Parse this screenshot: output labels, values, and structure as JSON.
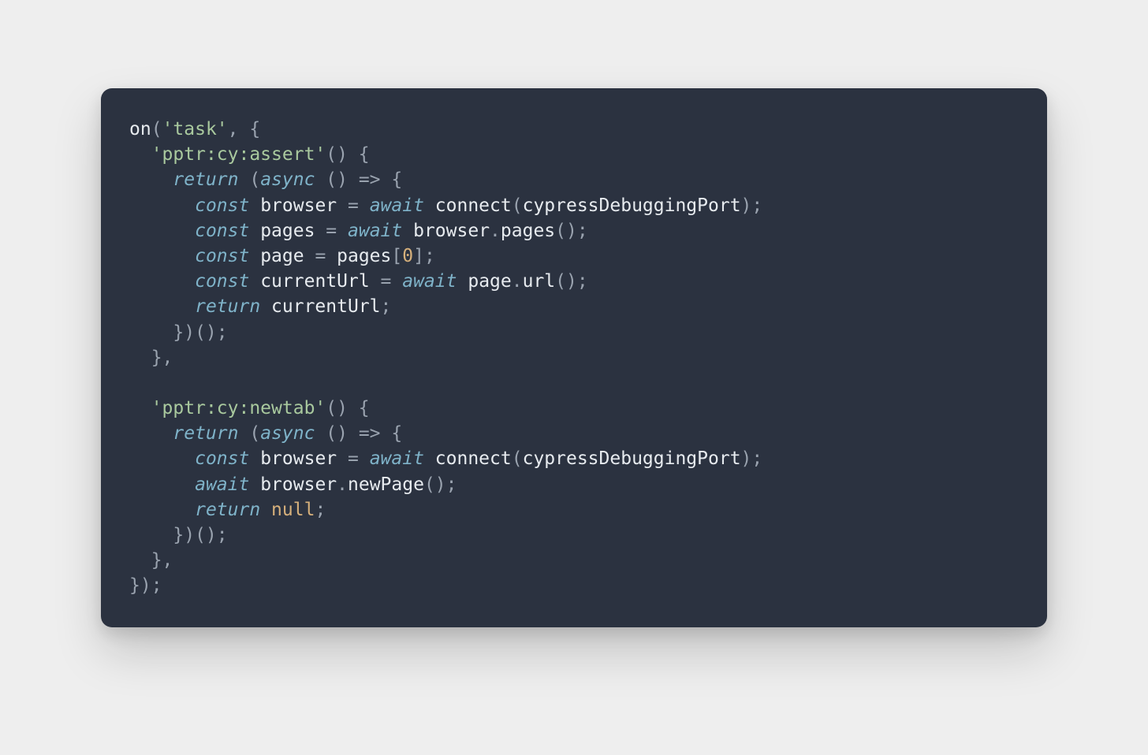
{
  "code": {
    "tokens": [
      [
        [
          "fn",
          "on"
        ],
        [
          "pun",
          "("
        ],
        [
          "str",
          "'task'"
        ],
        [
          "pun",
          ", {"
        ]
      ],
      [
        [
          "pun",
          "  "
        ],
        [
          "str",
          "'pptr:cy:assert'"
        ],
        [
          "pun",
          "() {"
        ]
      ],
      [
        [
          "pun",
          "    "
        ],
        [
          "kw",
          "return"
        ],
        [
          "pun",
          " ("
        ],
        [
          "kw",
          "async"
        ],
        [
          "pun",
          " () "
        ],
        [
          "pun",
          "=>"
        ],
        [
          "pun",
          " {"
        ]
      ],
      [
        [
          "pun",
          "      "
        ],
        [
          "kw",
          "const"
        ],
        [
          "pun",
          " "
        ],
        [
          "ident",
          "browser"
        ],
        [
          "pun",
          " = "
        ],
        [
          "kw",
          "await"
        ],
        [
          "pun",
          " "
        ],
        [
          "call",
          "connect"
        ],
        [
          "pun",
          "("
        ],
        [
          "ident",
          "cypressDebuggingPort"
        ],
        [
          "pun",
          ");"
        ]
      ],
      [
        [
          "pun",
          "      "
        ],
        [
          "kw",
          "const"
        ],
        [
          "pun",
          " "
        ],
        [
          "ident",
          "pages"
        ],
        [
          "pun",
          " = "
        ],
        [
          "kw",
          "await"
        ],
        [
          "pun",
          " "
        ],
        [
          "ident",
          "browser"
        ],
        [
          "pun",
          "."
        ],
        [
          "call",
          "pages"
        ],
        [
          "pun",
          "();"
        ]
      ],
      [
        [
          "pun",
          "      "
        ],
        [
          "kw",
          "const"
        ],
        [
          "pun",
          " "
        ],
        [
          "ident",
          "page"
        ],
        [
          "pun",
          " = "
        ],
        [
          "ident",
          "pages"
        ],
        [
          "pun",
          "["
        ],
        [
          "num",
          "0"
        ],
        [
          "pun",
          "];"
        ]
      ],
      [
        [
          "pun",
          "      "
        ],
        [
          "kw",
          "const"
        ],
        [
          "pun",
          " "
        ],
        [
          "ident",
          "currentUrl"
        ],
        [
          "pun",
          " = "
        ],
        [
          "kw",
          "await"
        ],
        [
          "pun",
          " "
        ],
        [
          "ident",
          "page"
        ],
        [
          "pun",
          "."
        ],
        [
          "call",
          "url"
        ],
        [
          "pun",
          "();"
        ]
      ],
      [
        [
          "pun",
          "      "
        ],
        [
          "kw",
          "return"
        ],
        [
          "pun",
          " "
        ],
        [
          "ident",
          "currentUrl"
        ],
        [
          "pun",
          ";"
        ]
      ],
      [
        [
          "pun",
          "    })();"
        ]
      ],
      [
        [
          "pun",
          "  },"
        ]
      ],
      [
        [
          "pun",
          ""
        ]
      ],
      [
        [
          "pun",
          "  "
        ],
        [
          "str",
          "'pptr:cy:newtab'"
        ],
        [
          "pun",
          "() {"
        ]
      ],
      [
        [
          "pun",
          "    "
        ],
        [
          "kw",
          "return"
        ],
        [
          "pun",
          " ("
        ],
        [
          "kw",
          "async"
        ],
        [
          "pun",
          " () "
        ],
        [
          "pun",
          "=>"
        ],
        [
          "pun",
          " {"
        ]
      ],
      [
        [
          "pun",
          "      "
        ],
        [
          "kw",
          "const"
        ],
        [
          "pun",
          " "
        ],
        [
          "ident",
          "browser"
        ],
        [
          "pun",
          " = "
        ],
        [
          "kw",
          "await"
        ],
        [
          "pun",
          " "
        ],
        [
          "call",
          "connect"
        ],
        [
          "pun",
          "("
        ],
        [
          "ident",
          "cypressDebuggingPort"
        ],
        [
          "pun",
          ");"
        ]
      ],
      [
        [
          "pun",
          "      "
        ],
        [
          "kw",
          "await"
        ],
        [
          "pun",
          " "
        ],
        [
          "ident",
          "browser"
        ],
        [
          "pun",
          "."
        ],
        [
          "call",
          "newPage"
        ],
        [
          "pun",
          "();"
        ]
      ],
      [
        [
          "pun",
          "      "
        ],
        [
          "kw",
          "return"
        ],
        [
          "pun",
          " "
        ],
        [
          "null",
          "null"
        ],
        [
          "pun",
          ";"
        ]
      ],
      [
        [
          "pun",
          "    })();"
        ]
      ],
      [
        [
          "pun",
          "  },"
        ]
      ],
      [
        [
          "pun",
          "});"
        ]
      ]
    ]
  },
  "colors": {
    "card_bg": "#2b3240",
    "page_bg": "#eeeeee"
  }
}
